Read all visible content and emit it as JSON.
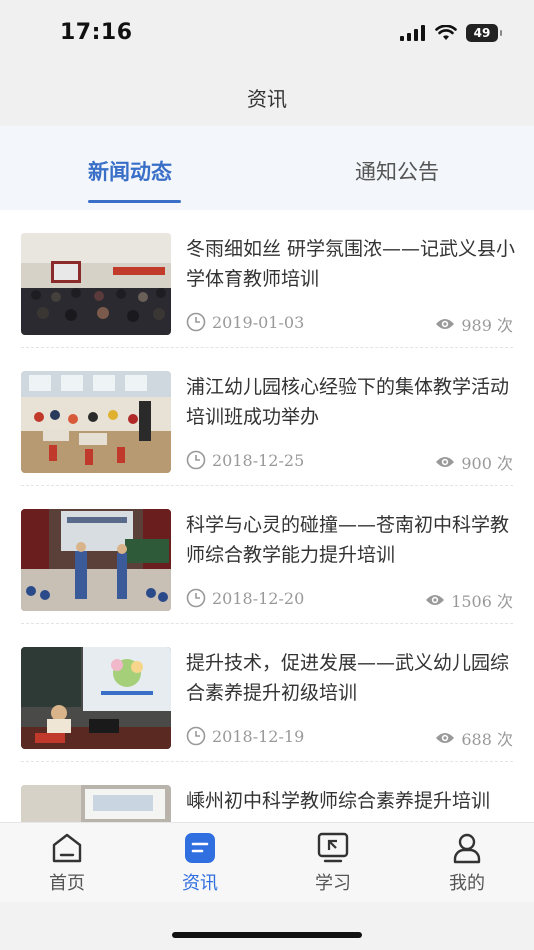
{
  "status": {
    "time": "17:16",
    "battery": "49"
  },
  "nav": {
    "title": "资讯"
  },
  "tabs": [
    {
      "label": "新闻动态",
      "active": true
    },
    {
      "label": "通知公告",
      "active": false
    }
  ],
  "news": [
    {
      "title": "冬雨细如丝 研学氛围浓——记武义县小学体育教师培训",
      "date": "2019-01-03",
      "views": "989 次"
    },
    {
      "title": "浦江幼儿园核心经验下的集体教学活动培训班成功举办",
      "date": "2018-12-25",
      "views": "900 次"
    },
    {
      "title": "科学与心灵的碰撞——苍南初中科学教师综合教学能力提升培训",
      "date": "2018-12-20",
      "views": "1506 次"
    },
    {
      "title": "提升技术，促进发展——武义幼儿园综合素养提升初级培训",
      "date": "2018-12-19",
      "views": "688 次"
    },
    {
      "title": "嵊州初中科学教师综合素养提升培训",
      "date": "",
      "views": ""
    }
  ],
  "tabbar": [
    {
      "label": "首页",
      "icon": "home-icon",
      "active": false
    },
    {
      "label": "资讯",
      "icon": "news-icon",
      "active": true
    },
    {
      "label": "学习",
      "icon": "study-icon",
      "active": false
    },
    {
      "label": "我的",
      "icon": "profile-icon",
      "active": false
    }
  ],
  "colors": {
    "accent": "#3a6fc8",
    "tab_active": "#2f6fe0",
    "meta": "#999999"
  }
}
